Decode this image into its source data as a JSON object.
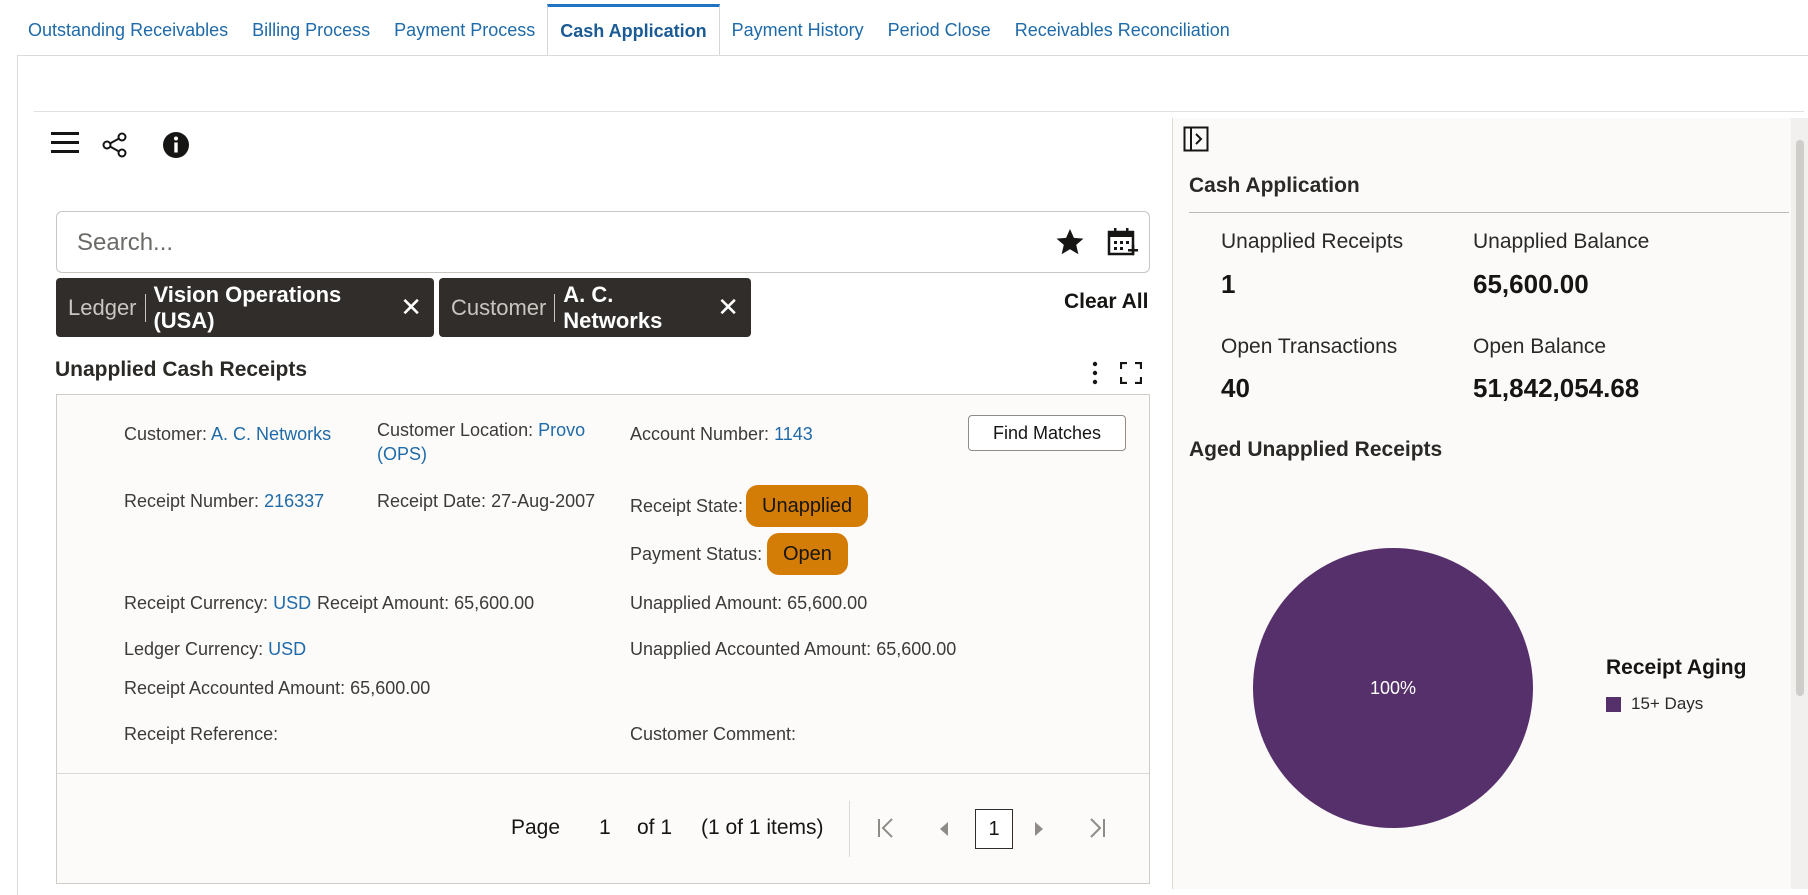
{
  "tabs": [
    {
      "label": "Outstanding Receivables"
    },
    {
      "label": "Billing Process"
    },
    {
      "label": "Payment Process"
    },
    {
      "label": "Cash Application",
      "active": true
    },
    {
      "label": "Payment History"
    },
    {
      "label": "Period Close"
    },
    {
      "label": "Receivables Reconciliation"
    }
  ],
  "search": {
    "placeholder": "Search..."
  },
  "filters": [
    {
      "key": "Ledger",
      "value": "Vision Operations (USA)"
    },
    {
      "key": "Customer",
      "value": "A. C. Networks"
    }
  ],
  "clear_all": "Clear All",
  "receipts": {
    "title": "Unapplied Cash Receipts",
    "customer_label": "Customer:",
    "customer": "A. C. Networks",
    "location_label": "Customer Location:",
    "location_line1": "Provo",
    "location_line2": "(OPS)",
    "account_label": "Account Number:",
    "account": "1143",
    "find_matches": "Find Matches",
    "receipt_number_label": "Receipt Number:",
    "receipt_number": "216337",
    "receipt_date_label": "Receipt Date:",
    "receipt_date": "27-Aug-2007",
    "receipt_state_label": "Receipt State:",
    "receipt_state": "Unapplied",
    "payment_status_label": "Payment Status:",
    "payment_status": "Open",
    "receipt_currency_label": "Receipt Currency:",
    "receipt_currency": "USD",
    "receipt_amount_label": "Receipt Amount:",
    "receipt_amount": "65,600.00",
    "unapplied_amount_label": "Unapplied Amount:",
    "unapplied_amount": "65,600.00",
    "ledger_currency_label": "Ledger Currency:",
    "ledger_currency": "USD",
    "unapplied_accounted_label": "Unapplied Accounted Amount:",
    "unapplied_accounted": "65,600.00",
    "receipt_accounted_label": "Receipt Accounted Amount:",
    "receipt_accounted": "65,600.00",
    "receipt_reference_label": "Receipt Reference:",
    "customer_comment_label": "Customer Comment:"
  },
  "pager": {
    "page_label": "Page",
    "page": "1",
    "of_label": "of 1",
    "items_label": "(1 of 1 items)",
    "current": "1"
  },
  "summary": {
    "title": "Cash Application",
    "metrics": [
      {
        "label": "Unapplied Receipts",
        "value": "1"
      },
      {
        "label": "Unapplied Balance",
        "value": "65,600.00"
      },
      {
        "label": "Open Transactions",
        "value": "40"
      },
      {
        "label": "Open Balance",
        "value": "51,842,054.68"
      }
    ],
    "aged_title": "Aged Unapplied Receipts"
  },
  "chart_data": {
    "type": "pie",
    "title": "",
    "legend_title": "Receipt Aging",
    "legend_position": "right",
    "slices": [
      {
        "label": "15+ Days",
        "value": 100,
        "display": "100%",
        "color": "#56306a"
      }
    ]
  }
}
